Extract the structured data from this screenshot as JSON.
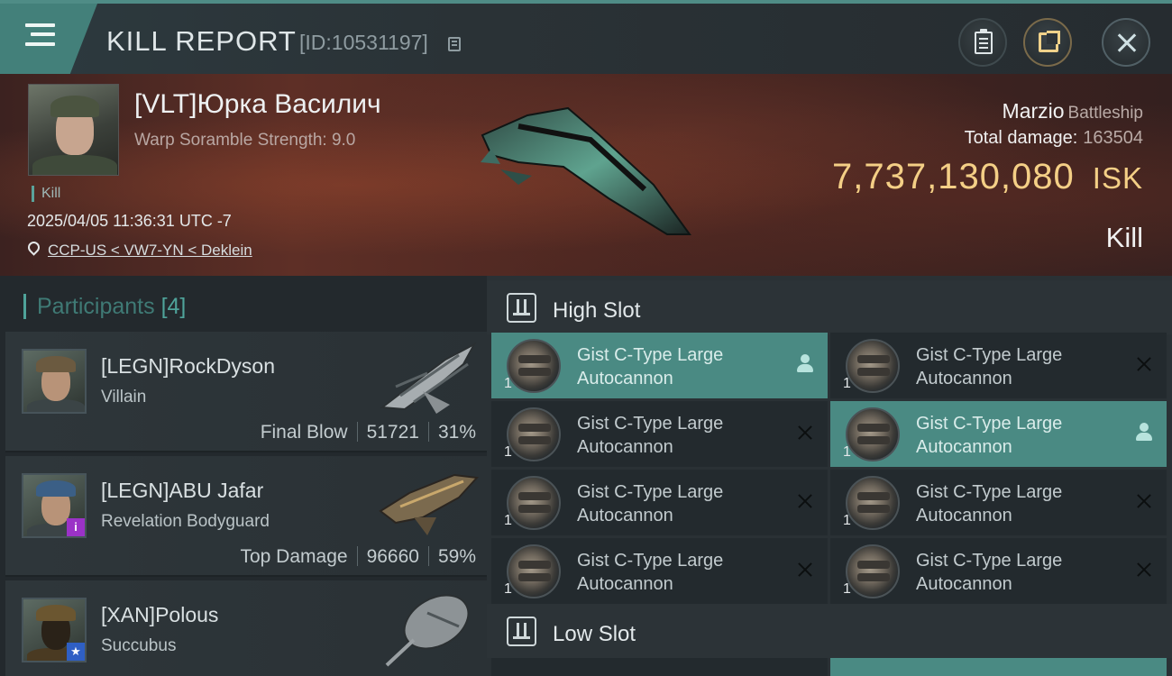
{
  "header": {
    "title": "KILL REPORT",
    "report_id": "[ID:10531197]",
    "icons": [
      "menu-icon",
      "copy-icon",
      "clipboard-icon",
      "share-icon",
      "close-icon"
    ]
  },
  "victim": {
    "name": "[VLT]Юрка Василич",
    "warp_scramble": "Warp Soramble Strength: 9.0",
    "kill_tag": "Kill",
    "timestamp": "2025/04/05 11:36:31 UTC -7",
    "location": "CCP-US < VW7-YN < Deklein",
    "ship_name": "Marzio",
    "ship_class": "Battleship",
    "total_damage_label": "Total damage:",
    "total_damage": "163504",
    "isk_value": "7,737,130,080",
    "isk_unit": "ISK",
    "result": "Kill"
  },
  "participants": {
    "label": "Participants",
    "count": "[4]",
    "items": [
      {
        "name": "[LEGN]RockDyson",
        "ship": "Villain",
        "role": "Final Blow",
        "damage": "51721",
        "percent": "31%"
      },
      {
        "name": "[LEGN]ABU Jafar",
        "ship": "Revelation Bodyguard",
        "role": "Top Damage",
        "damage": "96660",
        "percent": "59%",
        "badge": "i"
      },
      {
        "name": "[XAN]Polous",
        "ship": "Succubus",
        "badge": "★"
      }
    ]
  },
  "fitting": {
    "high_slot_label": "High Slot",
    "low_slot_label": "Low Slot",
    "high_slot_modules": [
      {
        "name": "Gist C-Type Large Autocannon",
        "qty": "1",
        "state": "active"
      },
      {
        "name": "Gist C-Type Large Autocannon",
        "qty": "1",
        "state": "dropped"
      },
      {
        "name": "Gist C-Type Large Autocannon",
        "qty": "1",
        "state": "dropped"
      },
      {
        "name": "Gist C-Type Large Autocannon",
        "qty": "1",
        "state": "active"
      },
      {
        "name": "Gist C-Type Large Autocannon",
        "qty": "1",
        "state": "dropped"
      },
      {
        "name": "Gist C-Type Large Autocannon",
        "qty": "1",
        "state": "dropped"
      },
      {
        "name": "Gist C-Type Large Autocannon",
        "qty": "1",
        "state": "dropped"
      },
      {
        "name": "Gist C-Type Large Autocannon",
        "qty": "1",
        "state": "dropped"
      }
    ]
  },
  "colors": {
    "accent_teal": "#4a8a83",
    "isk_gold": "#f4cf86",
    "panel_dark": "#23292d"
  }
}
